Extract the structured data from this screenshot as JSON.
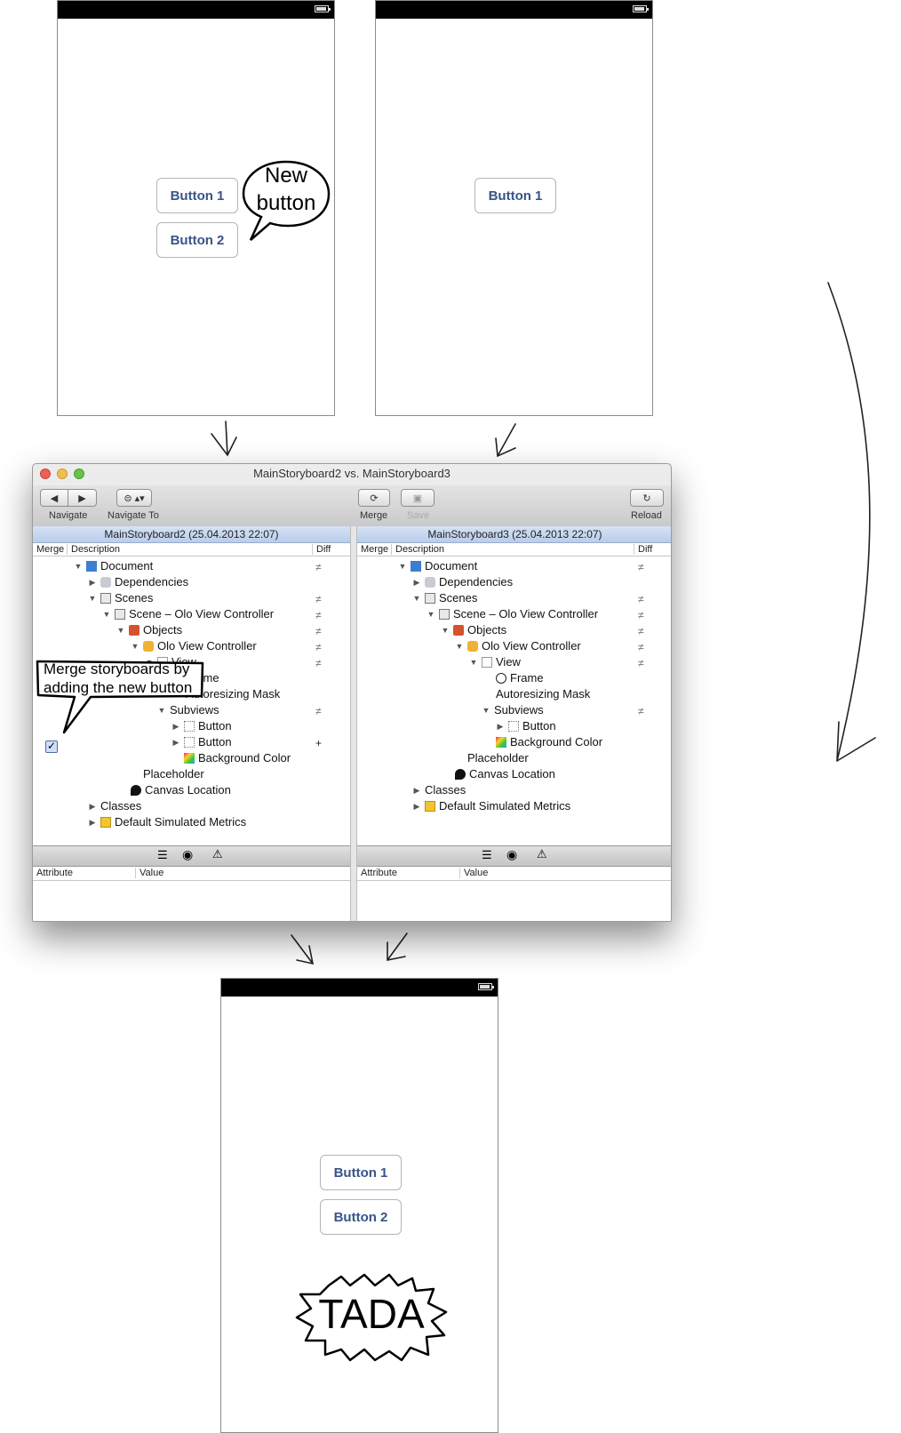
{
  "phones": {
    "left": {
      "buttons": [
        "Button 1",
        "Button 2"
      ]
    },
    "right": {
      "buttons": [
        "Button 1"
      ]
    },
    "result": {
      "buttons": [
        "Button 1",
        "Button 2"
      ]
    }
  },
  "callouts": {
    "new_button": [
      "New",
      "button"
    ],
    "merge_note": [
      "Merge storyboards by",
      "adding the new button"
    ],
    "tada": "TADA"
  },
  "window": {
    "title": "MainStoryboard2 vs. MainStoryboard3",
    "toolbar": {
      "navigate": "Navigate",
      "navigate_to": "Navigate To",
      "merge": "Merge",
      "save": "Save",
      "reload": "Reload"
    },
    "columns": {
      "merge": "Merge",
      "description": "Description",
      "diff": "Diff"
    },
    "attr_columns": {
      "attribute": "Attribute",
      "value": "Value"
    },
    "left_pane": {
      "header": "MainStoryboard2 (25.04.2013 22:07)",
      "rows": [
        {
          "label": "Document",
          "diff": "≠"
        },
        {
          "label": "Dependencies",
          "diff": ""
        },
        {
          "label": "Scenes",
          "diff": "≠"
        },
        {
          "label": "Scene – Olo View Controller",
          "diff": "≠"
        },
        {
          "label": "Objects",
          "diff": "≠"
        },
        {
          "label": "Olo View Controller",
          "diff": "≠"
        },
        {
          "label": "View",
          "diff": "≠"
        },
        {
          "label": "Frame",
          "diff": ""
        },
        {
          "label": "Autoresizing Mask",
          "diff": ""
        },
        {
          "label": "Subviews",
          "diff": "≠"
        },
        {
          "label": "Button",
          "diff": ""
        },
        {
          "label": "Button",
          "diff": "+"
        },
        {
          "label": "Background Color",
          "diff": ""
        },
        {
          "label": "Placeholder",
          "diff": ""
        },
        {
          "label": "Canvas Location",
          "diff": ""
        },
        {
          "label": "Classes",
          "diff": ""
        },
        {
          "label": "Default Simulated Metrics",
          "diff": ""
        }
      ]
    },
    "right_pane": {
      "header": "MainStoryboard3 (25.04.2013 22:07)",
      "rows": [
        {
          "label": "Document",
          "diff": "≠"
        },
        {
          "label": "Dependencies",
          "diff": ""
        },
        {
          "label": "Scenes",
          "diff": "≠"
        },
        {
          "label": "Scene – Olo View Controller",
          "diff": "≠"
        },
        {
          "label": "Objects",
          "diff": "≠"
        },
        {
          "label": "Olo View Controller",
          "diff": "≠"
        },
        {
          "label": "View",
          "diff": "≠"
        },
        {
          "label": "Frame",
          "diff": ""
        },
        {
          "label": "Autoresizing Mask",
          "diff": ""
        },
        {
          "label": "Subviews",
          "diff": "≠"
        },
        {
          "label": "Button",
          "diff": ""
        },
        {
          "label": "Background Color",
          "diff": ""
        },
        {
          "label": "Placeholder",
          "diff": ""
        },
        {
          "label": "Canvas Location",
          "diff": ""
        },
        {
          "label": "Classes",
          "diff": ""
        },
        {
          "label": "Default Simulated Metrics",
          "diff": ""
        }
      ]
    }
  }
}
